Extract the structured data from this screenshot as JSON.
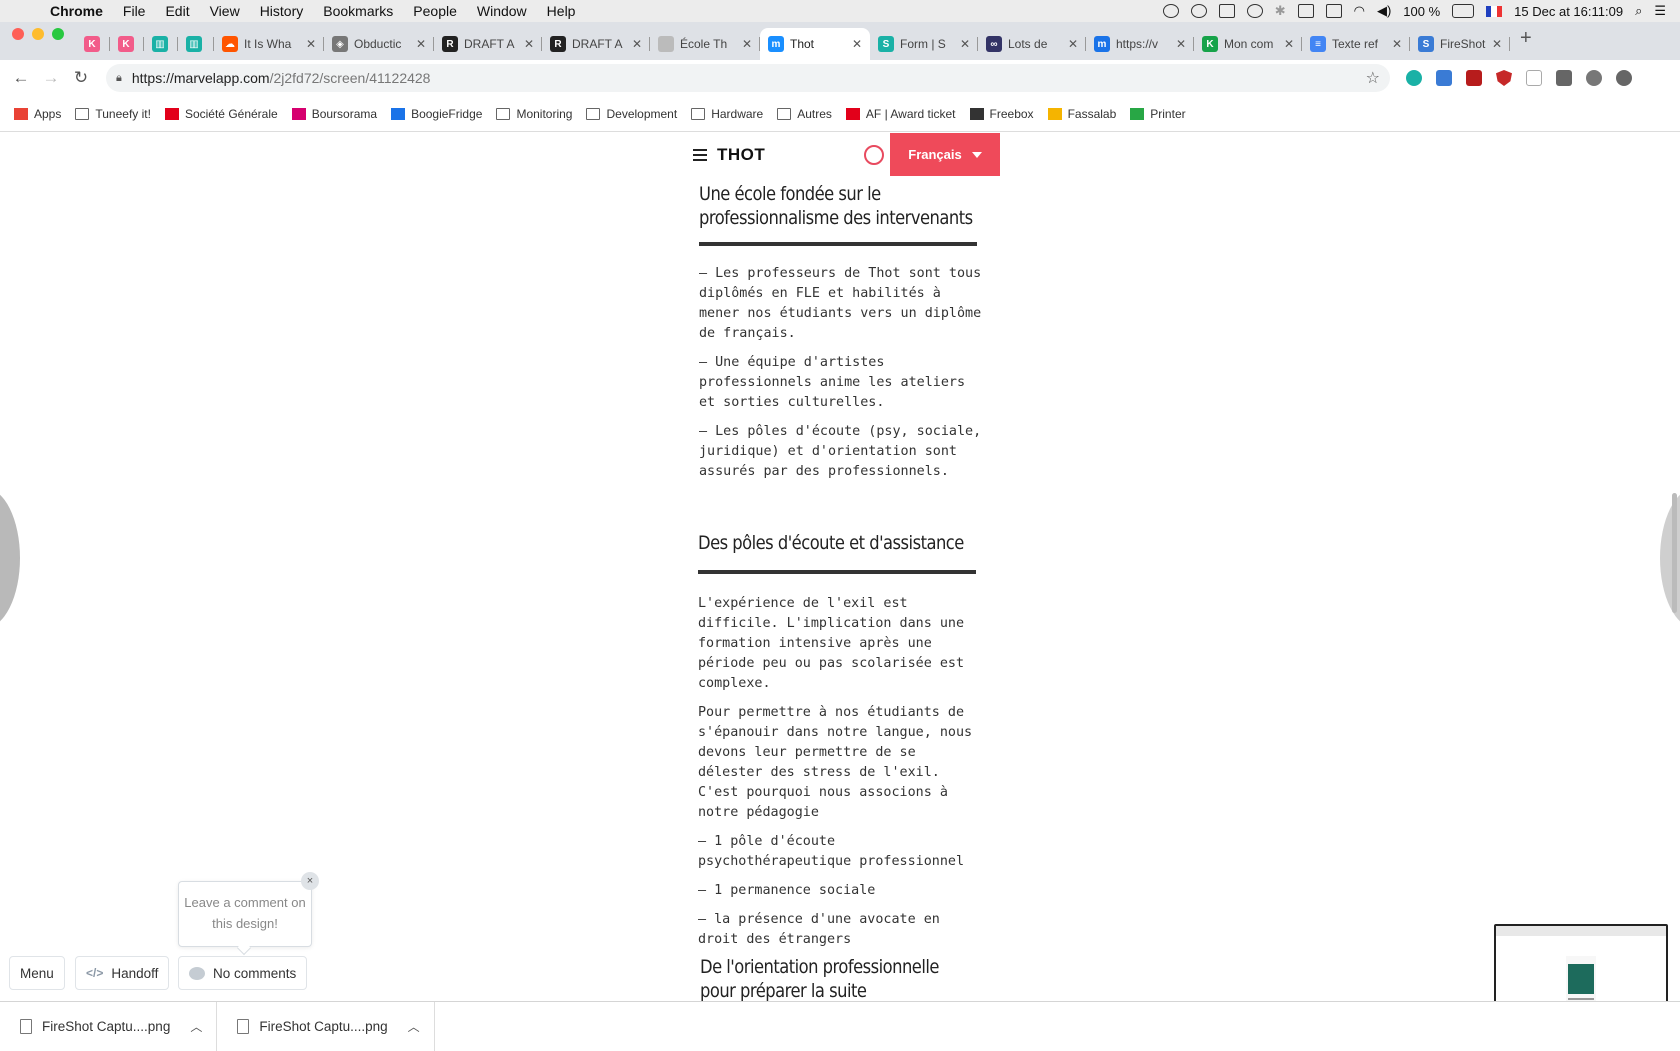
{
  "menubar": {
    "app": "Chrome",
    "items": [
      "File",
      "Edit",
      "View",
      "History",
      "Bookmarks",
      "People",
      "Window",
      "Help"
    ],
    "battery": "100 %",
    "datetime": "15 Dec at  16:11:09"
  },
  "tabs": [
    {
      "title": "",
      "fav_color": "#f25c8a",
      "fav_letter": "K"
    },
    {
      "title": "",
      "fav_color": "#f25c8a",
      "fav_letter": "K"
    },
    {
      "title": "",
      "fav_color": "#1ab1a6",
      "fav_letter": "▥"
    },
    {
      "title": "",
      "fav_color": "#1ab1a6",
      "fav_letter": "▥"
    },
    {
      "title": "It Is Wha",
      "fav_color": "#ff5500",
      "fav_letter": "☁"
    },
    {
      "title": "Obductic",
      "fav_color": "#777777",
      "fav_letter": "◈"
    },
    {
      "title": "DRAFT A",
      "fav_color": "#222222",
      "fav_letter": "R"
    },
    {
      "title": "DRAFT A",
      "fav_color": "#222222",
      "fav_letter": "R"
    },
    {
      "title": "École Th",
      "fav_color": "#bbbbbb",
      "fav_letter": ""
    },
    {
      "title": "Thot",
      "fav_color": "#1a8fff",
      "fav_letter": "m",
      "active": true
    },
    {
      "title": "Form | S",
      "fav_color": "#1ab1a6",
      "fav_letter": "S"
    },
    {
      "title": "Lots de",
      "fav_color": "#333366",
      "fav_letter": "∞"
    },
    {
      "title": "https://v",
      "fav_color": "#1a73e8",
      "fav_letter": "m"
    },
    {
      "title": "Mon com",
      "fav_color": "#17a34a",
      "fav_letter": "K"
    },
    {
      "title": "Texte ref",
      "fav_color": "#4285f4",
      "fav_letter": "≡"
    },
    {
      "title": "FireShot",
      "fav_color": "#3a7bd5",
      "fav_letter": "S"
    }
  ],
  "omnibox": {
    "host": "https://marvelapp.com",
    "path": "/2j2fd72/screen/41122428"
  },
  "bookmarks": [
    {
      "label": "Apps",
      "icon": "apps-grid-icon"
    },
    {
      "label": "Tuneefy it!",
      "icon": "page-icon"
    },
    {
      "label": "Société Générale",
      "icon": "socgen-icon"
    },
    {
      "label": "Boursorama",
      "icon": "boursorama-icon"
    },
    {
      "label": "BoogieFridge",
      "icon": "dsm-icon"
    },
    {
      "label": "Monitoring",
      "icon": "folder-icon"
    },
    {
      "label": "Development",
      "icon": "folder-icon"
    },
    {
      "label": "Hardware",
      "icon": "folder-icon"
    },
    {
      "label": "Autres",
      "icon": "folder-icon"
    },
    {
      "label": "AF | Award ticket",
      "icon": "airfrance-icon"
    },
    {
      "label": "Freebox",
      "icon": "freebox-icon"
    },
    {
      "label": "Fassalab",
      "icon": "fassalab-icon"
    },
    {
      "label": "Printer",
      "icon": "printer-icon"
    }
  ],
  "site": {
    "logo": "THOT",
    "language": "Français",
    "sections": {
      "s1_title": "Une école fondée sur le professionnalisme des intervenants",
      "s1_p1": "— Les professeurs de Thot sont tous diplômés en FLE et habilités à mener nos étudiants vers un diplôme de français.",
      "s1_p2": "— Une équipe d'artistes professionnels anime les ateliers et sorties culturelles.",
      "s1_p3": "— Les pôles d'écoute (psy, sociale, juridique) et d'orientation sont assurés par des professionnels.",
      "s2_title": "Des pôles d'écoute et d'assistance",
      "s2_p1": "L'expérience de l'exil est difficile. L'implication dans une formation intensive après une période peu ou pas scolarisée est complexe.",
      "s2_p2": "Pour permettre à nos étudiants de s'épanouir dans notre langue, nous devons leur permettre de se délester des stress de l'exil. C'est pourquoi nous associons à notre pédagogie",
      "s2_p3": "— 1 pôle d'écoute psychothérapeutique professionnel",
      "s2_p4": "— 1 permanence sociale",
      "s2_p5": "— la présence d'une avocate en droit des étrangers",
      "s3_title": "De l'orientation professionnelle pour préparer la suite"
    }
  },
  "marvel": {
    "tooltip": "Leave a comment on this design!",
    "close": "×",
    "menu": "Menu",
    "handoff": "Handoff",
    "handoff_icon": "</>",
    "comments": "No comments"
  },
  "downloads": [
    {
      "name": "FireShot Captu....png"
    },
    {
      "name": "FireShot Captu....png"
    }
  ],
  "colors": {
    "accent": "#ef4a5a",
    "rule": "#333333"
  }
}
